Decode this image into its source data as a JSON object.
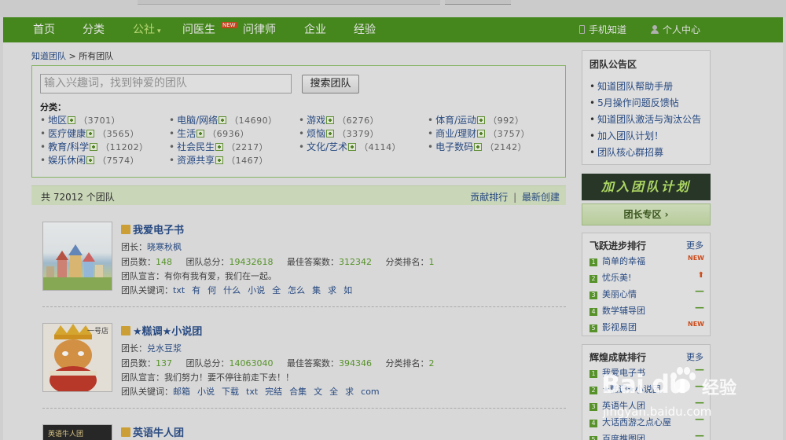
{
  "nav": {
    "items": [
      {
        "label": "首页"
      },
      {
        "label": "分类"
      },
      {
        "label": "公社",
        "caret": "▾"
      },
      {
        "label": "问医生",
        "badge": "NEW"
      },
      {
        "label": "问律师"
      },
      {
        "label": "企业"
      },
      {
        "label": "经验"
      }
    ],
    "right": {
      "phone": "手机知道",
      "user": "个人中心"
    }
  },
  "breadcrumb": {
    "root": "知道团队",
    "sep": ">",
    "current": "所有团队"
  },
  "search": {
    "placeholder": "输入兴趣词，找到钟爱的团队",
    "button": "搜索团队"
  },
  "categories": {
    "title": "分类：",
    "items": [
      {
        "name": "地区",
        "count": "（3701）"
      },
      {
        "name": "电脑/网络",
        "count": "（14690）"
      },
      {
        "name": "游戏",
        "count": "（6276）"
      },
      {
        "name": "体育/运动",
        "count": "（992）"
      },
      {
        "name": "医疗健康",
        "count": "（3565）"
      },
      {
        "name": "生活",
        "count": "（6936）"
      },
      {
        "name": "烦恼",
        "count": "（3379）"
      },
      {
        "name": "商业/理财",
        "count": "（3757）"
      },
      {
        "name": "教育/科学",
        "count": "（11202）"
      },
      {
        "name": "社会民生",
        "count": "（2217）"
      },
      {
        "name": "文化/艺术",
        "count": "（4114）"
      },
      {
        "name": "电子数码",
        "count": "（2142）"
      },
      {
        "name": "娱乐休闲",
        "count": "（7574）"
      },
      {
        "name": "资源共享",
        "count": "（1467）"
      }
    ]
  },
  "total": {
    "text": "共 72012 个团队",
    "link1": "贡献排行",
    "sep": "|",
    "link2": "最新创建"
  },
  "teams": [
    {
      "name": "我爱电子书",
      "leader_label": "团长：",
      "leader": "晓寒秋枫",
      "members_label": "团员数：",
      "members": "148",
      "score_label": "团队总分：",
      "score": "19432618",
      "best_label": "最佳答案数：",
      "best": "312342",
      "rank_label": "分类排名：",
      "rank": "1",
      "motto_label": "团队宣言：",
      "motto": "有你有我有爱，我们在一起。",
      "kw_label": "团队关键词：",
      "keywords": [
        "txt",
        "有",
        "何",
        "什么",
        "小说",
        "全",
        "怎么",
        "集",
        "求",
        "如"
      ]
    },
    {
      "name": "★糕调★小说团",
      "thumb_text": "一号店",
      "leader_label": "团长：",
      "leader": "兑水豆浆",
      "members_label": "团员数：",
      "members": "137",
      "score_label": "团队总分：",
      "score": "14063040",
      "best_label": "最佳答案数：",
      "best": "394346",
      "rank_label": "分类排名：",
      "rank": "2",
      "motto_label": "团队宣言：",
      "motto": "我们努力！要不停往前走下去！！",
      "kw_label": "团队关键词：",
      "keywords": [
        "邮箱",
        "小说",
        "下载",
        "txt",
        "完结",
        "合集",
        "文",
        "全",
        "求",
        "com"
      ]
    },
    {
      "name": "英语牛人团",
      "thumb_text": "英语牛人团"
    }
  ],
  "sidebar": {
    "notice": {
      "title": "团队公告区",
      "items": [
        "知道团队帮助手册",
        "5月操作问题反馈帖",
        "知道团队激活与淘汰公告",
        "加入团队计划！",
        "团队核心群招募"
      ]
    },
    "banner": "加入团队计划",
    "leader_zone": "团长专区 ›",
    "rank1": {
      "title": "飞跃进步排行",
      "more": "更多",
      "rows": [
        {
          "n": "1",
          "name": "简单的幸福",
          "trend": "NEW",
          "type": "new"
        },
        {
          "n": "2",
          "name": "忧乐美!",
          "trend": "⬆",
          "type": "up"
        },
        {
          "n": "3",
          "name": "美丽心情",
          "trend": "—",
          "type": "flat"
        },
        {
          "n": "4",
          "name": "数学辅导团",
          "trend": "—",
          "type": "flat"
        },
        {
          "n": "5",
          "name": "影视易团",
          "trend": "NEW",
          "type": "new"
        }
      ]
    },
    "rank2": {
      "title": "辉煌成就排行",
      "more": "更多",
      "rows": [
        {
          "n": "1",
          "name": "我爱电子书",
          "trend": "—",
          "type": "flat"
        },
        {
          "n": "2",
          "name": "★糕调★小说团",
          "trend": "—",
          "type": "flat"
        },
        {
          "n": "3",
          "name": "英语牛人团",
          "trend": "—",
          "type": "flat"
        },
        {
          "n": "4",
          "name": "大话西游之点心屋",
          "trend": "—",
          "type": "flat"
        },
        {
          "n": "5",
          "name": "百度推图团",
          "trend": "—",
          "type": "flat"
        }
      ]
    }
  },
  "watermark": {
    "logo": "Bai  du",
    "zh": "经验",
    "url": "jingyan.baidu.com"
  },
  "colors": {
    "nav_green": "#4a8f1f",
    "link_blue": "#2b4f8a",
    "value_green": "#5c9c2c",
    "new_orange": "#d9521e"
  }
}
